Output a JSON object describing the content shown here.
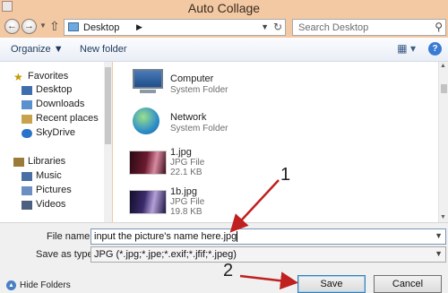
{
  "window": {
    "title": "Auto Collage"
  },
  "address": {
    "location": "Desktop",
    "search_placeholder": "Search Desktop"
  },
  "toolbar": {
    "organize": "Organize ▼",
    "new_folder": "New folder"
  },
  "sidebar": {
    "favorites": {
      "label": "Favorites",
      "items": [
        "Desktop",
        "Downloads",
        "Recent places",
        "SkyDrive"
      ]
    },
    "libraries": {
      "label": "Libraries",
      "items": [
        "Music",
        "Pictures",
        "Videos"
      ]
    }
  },
  "files": [
    {
      "name": "Computer",
      "type": "System Folder",
      "size": ""
    },
    {
      "name": "Network",
      "type": "System Folder",
      "size": ""
    },
    {
      "name": "1.jpg",
      "type": "JPG File",
      "size": "22.1 KB"
    },
    {
      "name": "1b.jpg",
      "type": "JPG File",
      "size": "19.8 KB"
    }
  ],
  "form": {
    "file_name_label": "File name:",
    "file_name_value": "input the picture's name here.jpg",
    "save_as_label": "Save as type:",
    "save_as_value": "JPG (*.jpg;*.jpe;*.exif;*.jfif;*.jpeg)"
  },
  "buttons": {
    "save": "Save",
    "cancel": "Cancel",
    "hide_folders": "Hide Folders"
  },
  "annotations": {
    "one": "1",
    "two": "2"
  },
  "colors": {
    "arrow": "#c0201f",
    "titlebar": "#f3c9a4",
    "accent": "#3a7bd5"
  }
}
